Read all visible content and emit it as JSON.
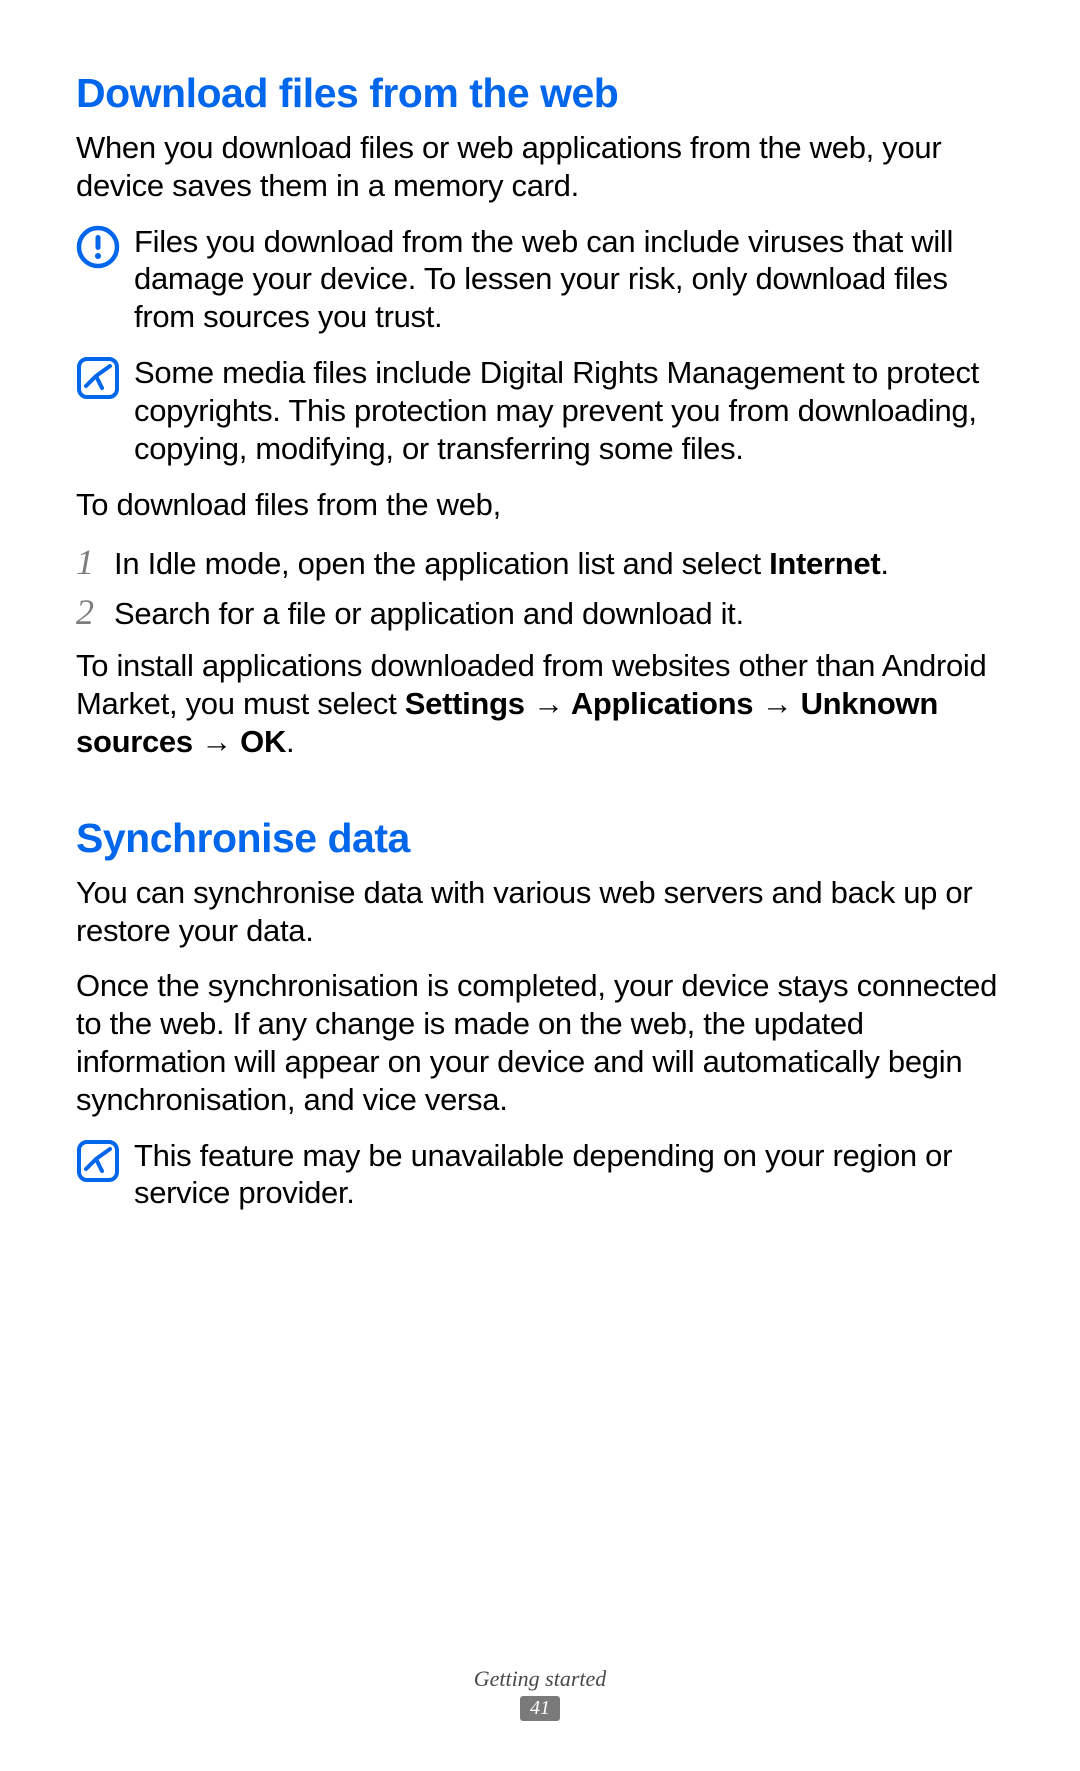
{
  "section1": {
    "heading": "Download files from the web",
    "intro": "When you download files or web applications from the web, your device saves them in a memory card.",
    "warning": "Files you download from the web can include viruses that will damage your device. To lessen your risk, only download files from sources you trust.",
    "note1": "Some media files include Digital Rights Management to protect copyrights. This protection may prevent you from downloading, copying, modifying, or transferring some files.",
    "instruction": "To download files from the web,",
    "step1_num": "1",
    "step1_text_a": "In Idle mode, open the application list and select ",
    "step1_text_b": "Internet",
    "step1_text_c": ".",
    "step2_num": "2",
    "step2_text": "Search for a file or application and download it.",
    "postnote_a": "To install applications downloaded from websites other than Android Market, you must select ",
    "postnote_b": "Settings",
    "postnote_arrow": " → ",
    "postnote_c": "Applications",
    "postnote_d": "Unknown sources",
    "postnote_e": "OK",
    "postnote_f": "."
  },
  "section2": {
    "heading": "Synchronise data",
    "para1": "You can synchronise data with various web servers and back up or restore your data.",
    "para2": "Once the synchronisation is completed, your device stays connected to the web. If any change is made on the web, the updated information will appear on your device and will automatically begin synchronisation, and vice versa.",
    "note": "This feature may be unavailable depending on your region or service provider."
  },
  "footer": {
    "section": "Getting started",
    "page": "41"
  }
}
